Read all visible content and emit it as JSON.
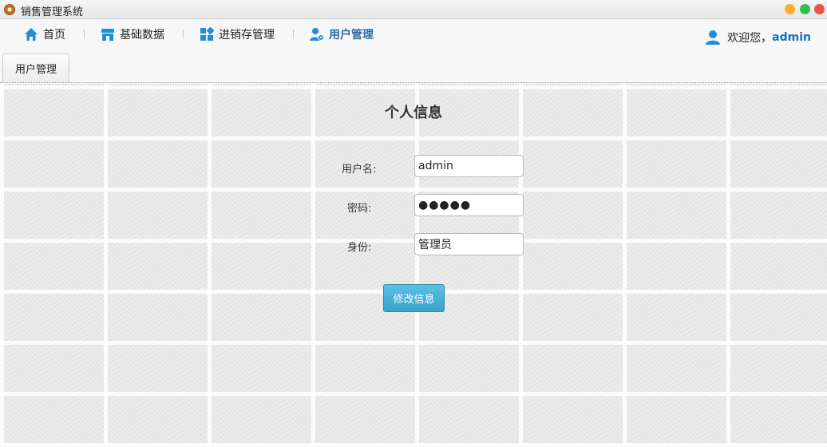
{
  "window": {
    "title": "销售管理系统"
  },
  "nav": {
    "items": [
      {
        "label": "首页",
        "icon": "home-icon"
      },
      {
        "label": "基础数据",
        "icon": "store-icon"
      },
      {
        "label": "进销存管理",
        "icon": "grid-icon"
      },
      {
        "label": "用户管理",
        "icon": "user-gear-icon",
        "active": true
      }
    ],
    "welcome": "欢迎您，",
    "username": "admin"
  },
  "tabs": [
    {
      "label": "用户管理",
      "active": true
    }
  ],
  "form": {
    "title": "个人信息",
    "username_label": "用户名:",
    "username_value": "admin",
    "password_label": "密码:",
    "password_value": "●●●●●",
    "role_label": "身份:",
    "role_value": "管理员",
    "submit_label": "修改信息"
  },
  "colors": {
    "accent": "#2a6aa5",
    "nav_icon": "#1e8fd6",
    "button": "#36a1cc"
  }
}
